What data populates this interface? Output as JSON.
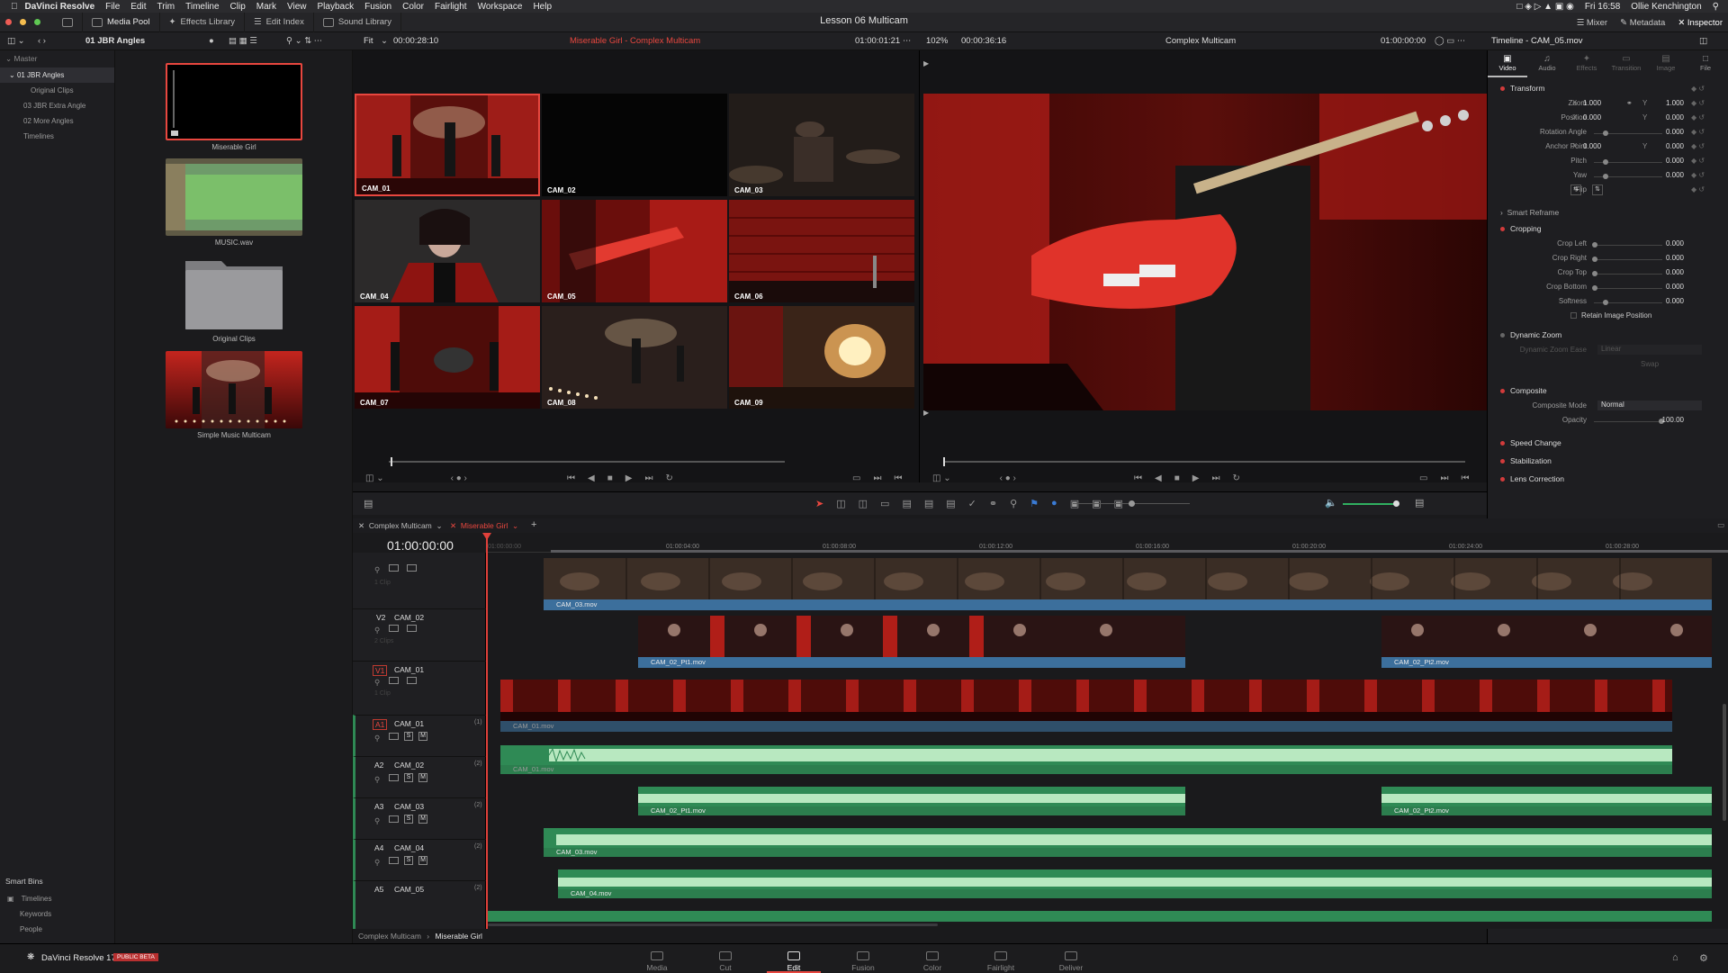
{
  "menubar": {
    "app": "DaVinci Resolve",
    "items": [
      "File",
      "Edit",
      "Trim",
      "Timeline",
      "Clip",
      "Mark",
      "View",
      "Playback",
      "Fusion",
      "Color",
      "Fairlight",
      "Workspace",
      "Help"
    ],
    "clock": "Fri 16:58",
    "user": "Ollie Kenchington"
  },
  "toolbar": {
    "media_pool": "Media Pool",
    "effects_library": "Effects Library",
    "edit_index": "Edit Index",
    "sound_library": "Sound Library",
    "project_title": "Lesson 06 Multicam",
    "mixer": "Mixer",
    "metadata": "Metadata",
    "inspector": "Inspector"
  },
  "subbar": {
    "bin_title": "01 JBR Angles",
    "fit": "Fit",
    "src_timecode": "00:00:28:10",
    "src_clip": "Miserable Girl - Complex Multicam",
    "src_tc2": "01:00:01:21",
    "zoom": "102%",
    "rec_timecode": "00:00:36:16",
    "rec_timeline": "Complex Multicam",
    "rec_tc2": "01:00:00:00",
    "inspector_title": "Timeline - CAM_05.mov"
  },
  "bins": {
    "master": "Master",
    "items": [
      "01 JBR Angles",
      "Original Clips",
      "03 JBR Extra Angle",
      "02 More Angles",
      "Timelines"
    ],
    "smart_bins": "Smart Bins",
    "smart_items": [
      "Timelines",
      "Keywords",
      "People"
    ]
  },
  "pool": {
    "clips": [
      "Miserable Girl",
      "MUSIC.wav",
      "Original Clips",
      "Simple Music Multicam"
    ]
  },
  "multicam": {
    "angles": [
      "CAM_01",
      "CAM_02",
      "CAM_03",
      "CAM_04",
      "CAM_05",
      "CAM_06",
      "CAM_07",
      "CAM_08",
      "CAM_09"
    ]
  },
  "inspector": {
    "tabs": [
      "Video",
      "Audio",
      "Effects",
      "Transition",
      "Image",
      "File"
    ],
    "transform": "Transform",
    "zoom_label": "Zoom",
    "zoom_x": "1.000",
    "zoom_y": "1.000",
    "position_label": "Position",
    "pos_x": "0.000",
    "pos_y": "0.000",
    "rotation_label": "Rotation Angle",
    "rotation": "0.000",
    "anchor_label": "Anchor Point",
    "anchor_x": "0.000",
    "anchor_y": "0.000",
    "pitch_label": "Pitch",
    "pitch": "0.000",
    "yaw_label": "Yaw",
    "yaw": "0.000",
    "flip_label": "Flip",
    "smart_reframe": "Smart Reframe",
    "cropping": "Cropping",
    "crop_left_label": "Crop Left",
    "crop_left": "0.000",
    "crop_right_label": "Crop Right",
    "crop_right": "0.000",
    "crop_top_label": "Crop Top",
    "crop_top": "0.000",
    "crop_bottom_label": "Crop Bottom",
    "crop_bottom": "0.000",
    "softness_label": "Softness",
    "softness": "0.000",
    "retain": "Retain Image Position",
    "dynamic_zoom": "Dynamic Zoom",
    "dz_ease_label": "Dynamic Zoom Ease",
    "dz_ease": "Linear",
    "swap": "Swap",
    "composite": "Composite",
    "comp_mode_label": "Composite Mode",
    "comp_mode": "Normal",
    "opacity_label": "Opacity",
    "opacity": "100.00",
    "speed_change": "Speed Change",
    "stabilization": "Stabilization",
    "lens_correction": "Lens Correction"
  },
  "timeline": {
    "tabs": [
      "Complex Multicam",
      "Miserable Girl"
    ],
    "timecode": "01:00:00:00",
    "ruler": [
      "01:00:00:00",
      "01:00:04:00",
      "01:00:08:00",
      "01:00:12:00",
      "01:00:16:00",
      "01:00:20:00",
      "01:00:24:00",
      "01:00:28:00"
    ],
    "tracks": {
      "v3_clips": "1 Clip",
      "v2_id": "V2",
      "v2_name": "CAM_02",
      "v2_clips": "2 Clips",
      "v1_id": "V1",
      "v1_name": "CAM_01",
      "v1_clips": "1 Clip",
      "a1_id": "A1",
      "a1_name": "CAM_01",
      "a1_ch": "(1)",
      "a2_id": "A2",
      "a2_name": "CAM_02",
      "a2_ch": "(2)",
      "a3_id": "A3",
      "a3_name": "CAM_03",
      "a3_ch": "(2)",
      "a4_id": "A4",
      "a4_name": "CAM_04",
      "a4_ch": "(2)",
      "a5_id": "A5",
      "a5_name": "CAM_05",
      "a5_ch": "(2)"
    },
    "clips": {
      "v3": "CAM_03.mov",
      "v2a": "CAM_02_Pt1.mov",
      "v2b": "CAM_02_Pt2.mov",
      "v1": "CAM_01.mov",
      "a1": "CAM_01.mov",
      "a2a": "CAM_02_Pt1.mov",
      "a2b": "CAM_02_Pt2.mov",
      "a3": "CAM_03.mov",
      "a4": "CAM_04.mov"
    },
    "solo": "S",
    "mute": "M",
    "breadcrumb": [
      "Complex Multicam",
      "Miserable Girl"
    ]
  },
  "bottombar": {
    "app_name": "DaVinci Resolve 17",
    "badge": "PUBLIC BETA",
    "pages": [
      "Media",
      "Cut",
      "Edit",
      "Fusion",
      "Color",
      "Fairlight",
      "Deliver"
    ],
    "active": "Edit"
  },
  "colors": {
    "accent": "#e8473f",
    "video_clip": "#3c6f9c",
    "audio_clip": "#2f8a55",
    "playhead": "#e0403a"
  }
}
